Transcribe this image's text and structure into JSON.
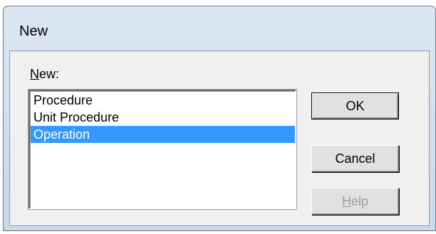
{
  "window": {
    "title": "New"
  },
  "list": {
    "label_accel": "N",
    "label_rest": "ew:",
    "items": [
      {
        "label": "Procedure",
        "selected": false
      },
      {
        "label": "Unit Procedure",
        "selected": false
      },
      {
        "label": "Operation",
        "selected": true
      }
    ]
  },
  "buttons": {
    "ok": "OK",
    "cancel": "Cancel",
    "help_accel": "H",
    "help_rest": "elp",
    "help_enabled": false
  },
  "colors": {
    "selection": "#3399ff",
    "dialog_face": "#f0f0f0",
    "disabled_text": "#a0a0a0"
  }
}
